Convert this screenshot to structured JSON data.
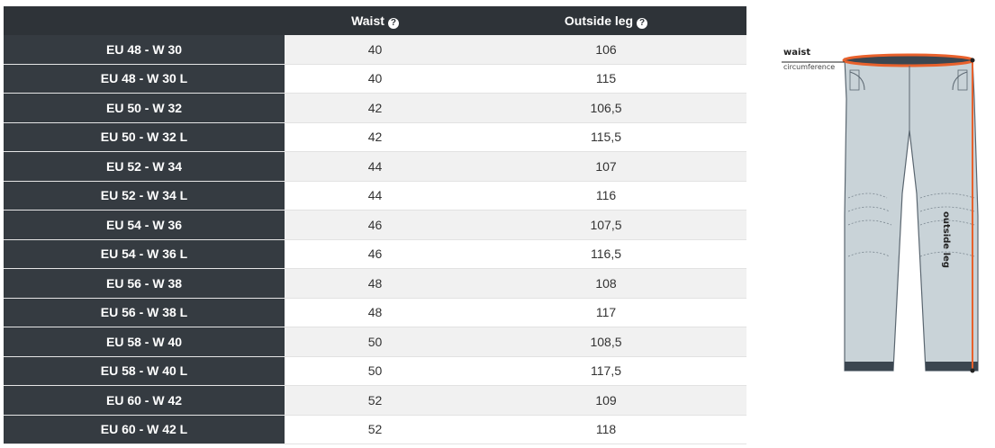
{
  "table": {
    "headers": {
      "size": "",
      "waist": "Waist",
      "outside_leg": "Outside leg",
      "help_glyph": "?"
    },
    "rows": [
      {
        "size": "EU 48 - W 30",
        "waist": "40",
        "outside_leg": "106"
      },
      {
        "size": "EU 48 - W 30 L",
        "waist": "40",
        "outside_leg": "115"
      },
      {
        "size": "EU 50 - W 32",
        "waist": "42",
        "outside_leg": "106,5"
      },
      {
        "size": "EU 50 - W 32 L",
        "waist": "42",
        "outside_leg": "115,5"
      },
      {
        "size": "EU 52 - W 34",
        "waist": "44",
        "outside_leg": "107"
      },
      {
        "size": "EU 52 - W 34 L",
        "waist": "44",
        "outside_leg": "116"
      },
      {
        "size": "EU 54 - W 36",
        "waist": "46",
        "outside_leg": "107,5"
      },
      {
        "size": "EU 54 - W 36 L",
        "waist": "46",
        "outside_leg": "116,5"
      },
      {
        "size": "EU 56 - W 38",
        "waist": "48",
        "outside_leg": "108"
      },
      {
        "size": "EU 56 - W 38 L",
        "waist": "48",
        "outside_leg": "117"
      },
      {
        "size": "EU 58 - W 40",
        "waist": "50",
        "outside_leg": "108,5"
      },
      {
        "size": "EU 58 - W 40 L",
        "waist": "50",
        "outside_leg": "117,5"
      },
      {
        "size": "EU 60 - W 42",
        "waist": "52",
        "outside_leg": "109"
      },
      {
        "size": "EU 60 - W 42 L",
        "waist": "52",
        "outside_leg": "118"
      }
    ]
  },
  "diagram": {
    "waist_label": "waist",
    "circumference_label": "circumference",
    "outside_leg_label": "outside leg",
    "icon": "trousers-measurement-diagram",
    "colors": {
      "header_bg": "#2e3338",
      "size_cell_bg": "#353b41",
      "measure_line": "#e8612c",
      "pants_fill": "#c9d3d8"
    }
  }
}
